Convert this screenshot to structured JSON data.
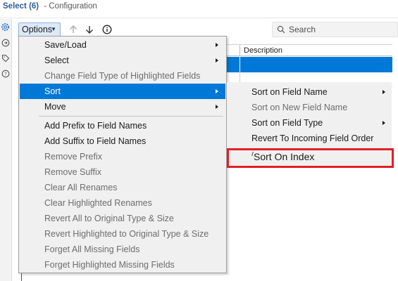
{
  "window": {
    "title": "Select (6)",
    "subtitle": "- Configuration"
  },
  "toolbar": {
    "options_label": "Options",
    "search_placeholder": "Search"
  },
  "grid": {
    "column_description": "Description"
  },
  "menu": {
    "items": [
      {
        "label": "Save/Load",
        "submenu": true,
        "disabled": false
      },
      {
        "label": "Select",
        "submenu": true,
        "disabled": false
      },
      {
        "label": "Change Field Type of Highlighted Fields",
        "submenu": false,
        "disabled": true
      },
      {
        "label": "Sort",
        "submenu": true,
        "disabled": false,
        "highlighted": true
      },
      {
        "label": "Move",
        "submenu": true,
        "disabled": false
      },
      {
        "label": "Add Prefix to Field Names",
        "submenu": false,
        "disabled": false
      },
      {
        "label": "Add Suffix to Field Names",
        "submenu": false,
        "disabled": false
      },
      {
        "label": "Remove Prefix",
        "submenu": false,
        "disabled": true
      },
      {
        "label": "Remove Suffix",
        "submenu": false,
        "disabled": true
      },
      {
        "label": "Clear All Renames",
        "submenu": false,
        "disabled": true
      },
      {
        "label": "Clear Highlighted Renames",
        "submenu": false,
        "disabled": true
      },
      {
        "label": "Revert All to Original Type & Size",
        "submenu": false,
        "disabled": true
      },
      {
        "label": "Revert Highlighted to Original Type & Size",
        "submenu": false,
        "disabled": true
      },
      {
        "label": "Forget All Missing Fields",
        "submenu": false,
        "disabled": true
      },
      {
        "label": "Forget Highlighted Missing Fields",
        "submenu": false,
        "disabled": true
      }
    ]
  },
  "sort_submenu": {
    "items": [
      {
        "label": "Sort on Field Name",
        "submenu": true,
        "disabled": false
      },
      {
        "label": "Sort on New Field Name",
        "submenu": false,
        "disabled": true
      },
      {
        "label": "Sort on Field Type",
        "submenu": true,
        "disabled": false
      },
      {
        "label": "Revert To Incoming Field Order",
        "submenu": false,
        "disabled": false
      },
      {
        "label": "Sort On Index",
        "submenu": false,
        "disabled": false
      }
    ]
  },
  "colors": {
    "highlight": "#0078d7",
    "annotation_box": "#e41e26",
    "title_text": "#2d5d9e"
  },
  "icons": {
    "side": [
      "gear-icon",
      "circle-arrow-icon",
      "tag-icon",
      "help-icon"
    ],
    "toolbar": [
      "arrow-up-icon",
      "arrow-down-icon",
      "info-icon"
    ],
    "search": "search-icon"
  }
}
